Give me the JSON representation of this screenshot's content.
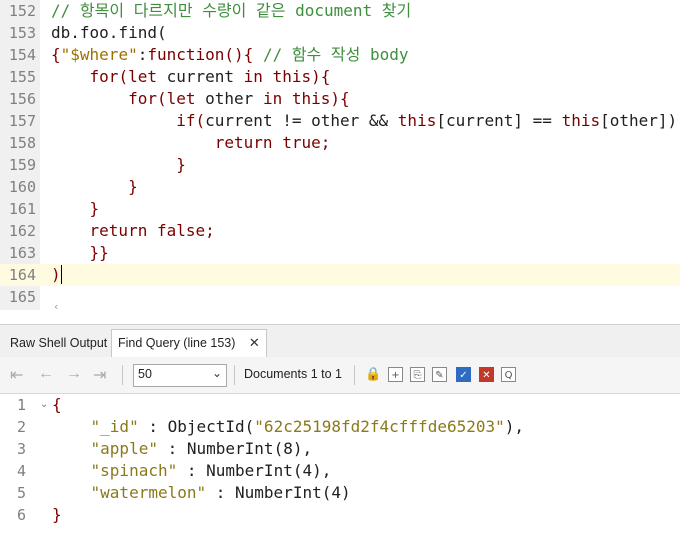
{
  "editor": {
    "lines": [
      {
        "num": "152",
        "tokens": [
          {
            "t": "// 항목이 다르지만 수량이 같은 document 찾기",
            "c": "c-comment"
          }
        ]
      },
      {
        "num": "153",
        "tokens": [
          {
            "t": "db.foo.find(",
            "c": "c-plain"
          }
        ]
      },
      {
        "num": "154",
        "tokens": [
          {
            "t": "{",
            "c": "c-kw"
          },
          {
            "t": "\"$where\"",
            "c": "c-str"
          },
          {
            "t": ":",
            "c": "c-plain"
          },
          {
            "t": "function",
            "c": "c-kw"
          },
          {
            "t": "(){ ",
            "c": "c-kw"
          },
          {
            "t": "// 함수 작성 body",
            "c": "c-comment"
          }
        ]
      },
      {
        "num": "155",
        "tokens": [
          {
            "t": "    for",
            "c": "c-kw"
          },
          {
            "t": "(",
            "c": "c-kw"
          },
          {
            "t": "let ",
            "c": "c-kw"
          },
          {
            "t": "current ",
            "c": "c-plain"
          },
          {
            "t": "in ",
            "c": "c-kw"
          },
          {
            "t": "this",
            "c": "c-kw"
          },
          {
            "t": "){",
            "c": "c-kw"
          }
        ]
      },
      {
        "num": "156",
        "tokens": [
          {
            "t": "        for",
            "c": "c-kw"
          },
          {
            "t": "(",
            "c": "c-kw"
          },
          {
            "t": "let ",
            "c": "c-kw"
          },
          {
            "t": "other ",
            "c": "c-plain"
          },
          {
            "t": "in ",
            "c": "c-kw"
          },
          {
            "t": "this",
            "c": "c-kw"
          },
          {
            "t": "){",
            "c": "c-kw"
          }
        ]
      },
      {
        "num": "157",
        "tokens": [
          {
            "t": "             if",
            "c": "c-kw"
          },
          {
            "t": "(",
            "c": "c-kw"
          },
          {
            "t": "current != other && ",
            "c": "c-plain"
          },
          {
            "t": "this",
            "c": "c-kw"
          },
          {
            "t": "[current] == ",
            "c": "c-plain"
          },
          {
            "t": "this",
            "c": "c-kw"
          },
          {
            "t": "[other])  {",
            "c": "c-plain"
          }
        ]
      },
      {
        "num": "158",
        "tokens": [
          {
            "t": "                 return true;",
            "c": "c-kw"
          }
        ]
      },
      {
        "num": "159",
        "tokens": [
          {
            "t": "             }",
            "c": "c-kw"
          }
        ]
      },
      {
        "num": "160",
        "tokens": [
          {
            "t": "        }",
            "c": "c-kw"
          }
        ]
      },
      {
        "num": "161",
        "tokens": [
          {
            "t": "    }",
            "c": "c-kw"
          }
        ]
      },
      {
        "num": "162",
        "tokens": [
          {
            "t": "    return false;",
            "c": "c-kw"
          }
        ]
      },
      {
        "num": "163",
        "tokens": [
          {
            "t": "    }}",
            "c": "c-kw"
          }
        ]
      },
      {
        "num": "164",
        "tokens": [
          {
            "t": ")",
            "c": "c-kw"
          }
        ],
        "active": true
      },
      {
        "num": "165",
        "tokens": []
      }
    ]
  },
  "tabs": {
    "raw_label": "Raw Shell Output",
    "find_label": "Find Query (line 153)",
    "close_glyph": "✕"
  },
  "toolbar": {
    "page_size": "50",
    "documents_label": "Documents 1 to 1"
  },
  "result": {
    "lines": [
      {
        "num": "1",
        "fold": true,
        "tokens": [
          {
            "t": "{",
            "c": "c-rbr"
          }
        ]
      },
      {
        "num": "2",
        "tokens": [
          {
            "t": "    \"_id\"",
            "c": "c-key"
          },
          {
            "t": " : ObjectId(",
            "c": "c-plain"
          },
          {
            "t": "\"62c25198fd2f4cfffde65203\"",
            "c": "c-key"
          },
          {
            "t": "),",
            "c": "c-plain"
          }
        ]
      },
      {
        "num": "3",
        "tokens": [
          {
            "t": "    \"apple\"",
            "c": "c-key"
          },
          {
            "t": " : NumberInt(8),",
            "c": "c-plain"
          }
        ]
      },
      {
        "num": "4",
        "tokens": [
          {
            "t": "    \"spinach\"",
            "c": "c-key"
          },
          {
            "t": " : NumberInt(4),",
            "c": "c-plain"
          }
        ]
      },
      {
        "num": "5",
        "tokens": [
          {
            "t": "    \"watermelon\"",
            "c": "c-key"
          },
          {
            "t": " : NumberInt(4)",
            "c": "c-plain"
          }
        ]
      },
      {
        "num": "6",
        "tokens": [
          {
            "t": "}",
            "c": "c-rbr"
          }
        ]
      }
    ]
  }
}
